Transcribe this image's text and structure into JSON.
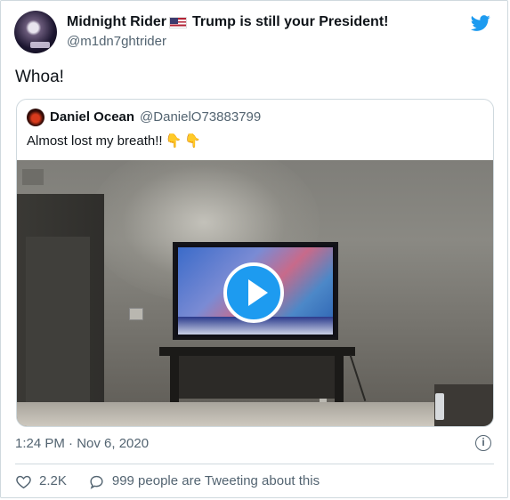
{
  "author": {
    "display_name": "Midnight Rider",
    "name_suffix": "Trump is still your President!",
    "handle": "@m1dn7ghtrider",
    "avatar_text": "Midnight Rider"
  },
  "tweet": {
    "text": "Whoa!",
    "timestamp": "1:24 PM · Nov 6, 2020"
  },
  "quoted_tweet": {
    "display_name": "Daniel Ocean",
    "handle": "@DanielO73883799",
    "text": "Almost lost my breath!!"
  },
  "stats": {
    "likes": "2.2K",
    "tweeting_about": "999 people are Tweeting about this"
  },
  "colors": {
    "accent": "#1d9bf0",
    "text_primary": "#0f1419",
    "text_secondary": "#536471",
    "border": "#cfd9de"
  },
  "icons": {
    "brand": "twitter-bird-icon",
    "flag": "us-flag-icon",
    "emoji": "backhand-index-pointing-down-icon",
    "play": "play-icon",
    "info": "info-icon",
    "like": "heart-icon",
    "reply": "speech-bubble-icon"
  }
}
